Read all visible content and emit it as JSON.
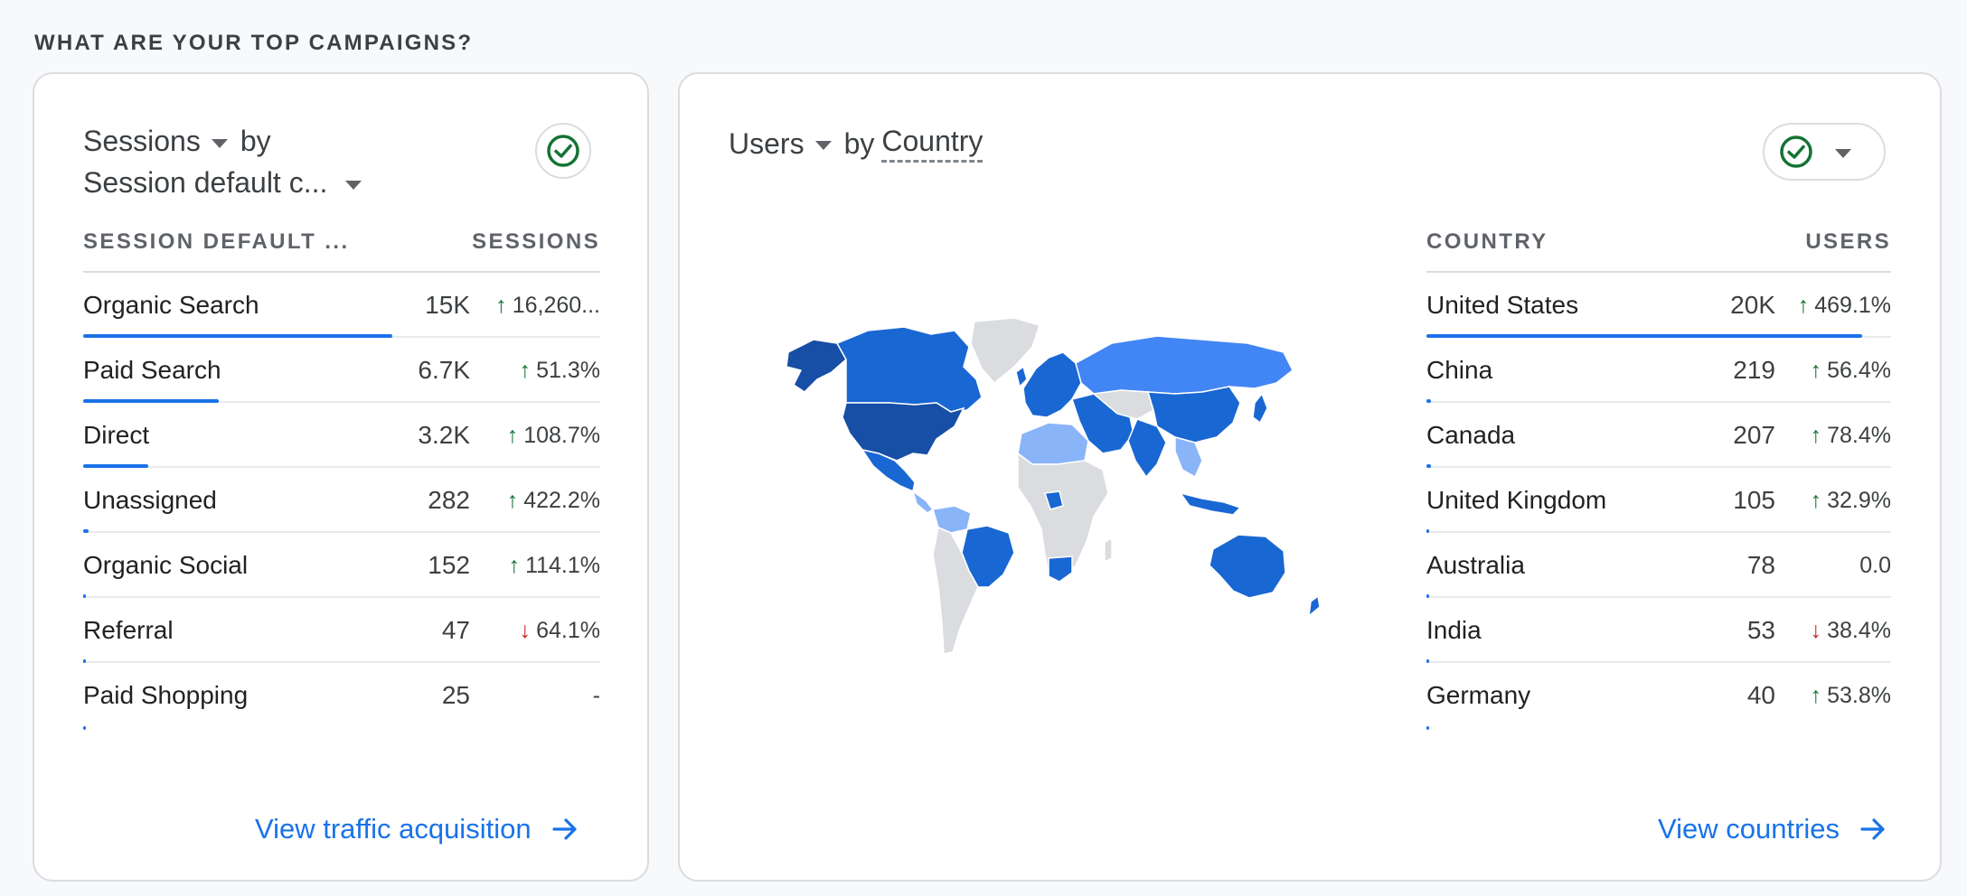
{
  "section_title": "WHAT ARE YOUR TOP CAMPAIGNS?",
  "left_card": {
    "metric": "Sessions",
    "by": "by",
    "dimension": "Session default c...",
    "columns": [
      "SESSION DEFAULT ...",
      "SESSIONS"
    ],
    "rows": [
      {
        "name": "Organic Search",
        "value": "15K",
        "change": "16,260...",
        "dir": "up",
        "share": 1.0
      },
      {
        "name": "Paid Search",
        "value": "6.7K",
        "change": "51.3%",
        "dir": "up",
        "share": 0.44
      },
      {
        "name": "Direct",
        "value": "3.2K",
        "change": "108.7%",
        "dir": "up",
        "share": 0.21
      },
      {
        "name": "Unassigned",
        "value": "282",
        "change": "422.2%",
        "dir": "up",
        "share": 0.019
      },
      {
        "name": "Organic Social",
        "value": "152",
        "change": "114.1%",
        "dir": "up",
        "share": 0.01
      },
      {
        "name": "Referral",
        "value": "47",
        "change": "64.1%",
        "dir": "down",
        "share": 0.003
      },
      {
        "name": "Paid Shopping",
        "value": "25",
        "change": "-",
        "dir": "none",
        "share": 0.002
      }
    ],
    "link": "View traffic acquisition"
  },
  "right_card": {
    "metric": "Users",
    "by": "by",
    "dimension": "Country",
    "columns": [
      "COUNTRY",
      "USERS"
    ],
    "rows": [
      {
        "name": "United States",
        "value": "20K",
        "change": "469.1%",
        "dir": "up",
        "share": 1.0
      },
      {
        "name": "China",
        "value": "219",
        "change": "56.4%",
        "dir": "up",
        "share": 0.011
      },
      {
        "name": "Canada",
        "value": "207",
        "change": "78.4%",
        "dir": "up",
        "share": 0.01
      },
      {
        "name": "United Kingdom",
        "value": "105",
        "change": "32.9%",
        "dir": "up",
        "share": 0.005
      },
      {
        "name": "Australia",
        "value": "78",
        "change": "0.0",
        "dir": "none",
        "share": 0.004
      },
      {
        "name": "India",
        "value": "53",
        "change": "38.4%",
        "dir": "down",
        "share": 0.003
      },
      {
        "name": "Germany",
        "value": "40",
        "change": "53.8%",
        "dir": "up",
        "share": 0.002
      }
    ],
    "link": "View countries"
  },
  "colors": {
    "accent": "#1a73e8",
    "up": "#137333",
    "down": "#c5221f",
    "check": "#137333"
  }
}
